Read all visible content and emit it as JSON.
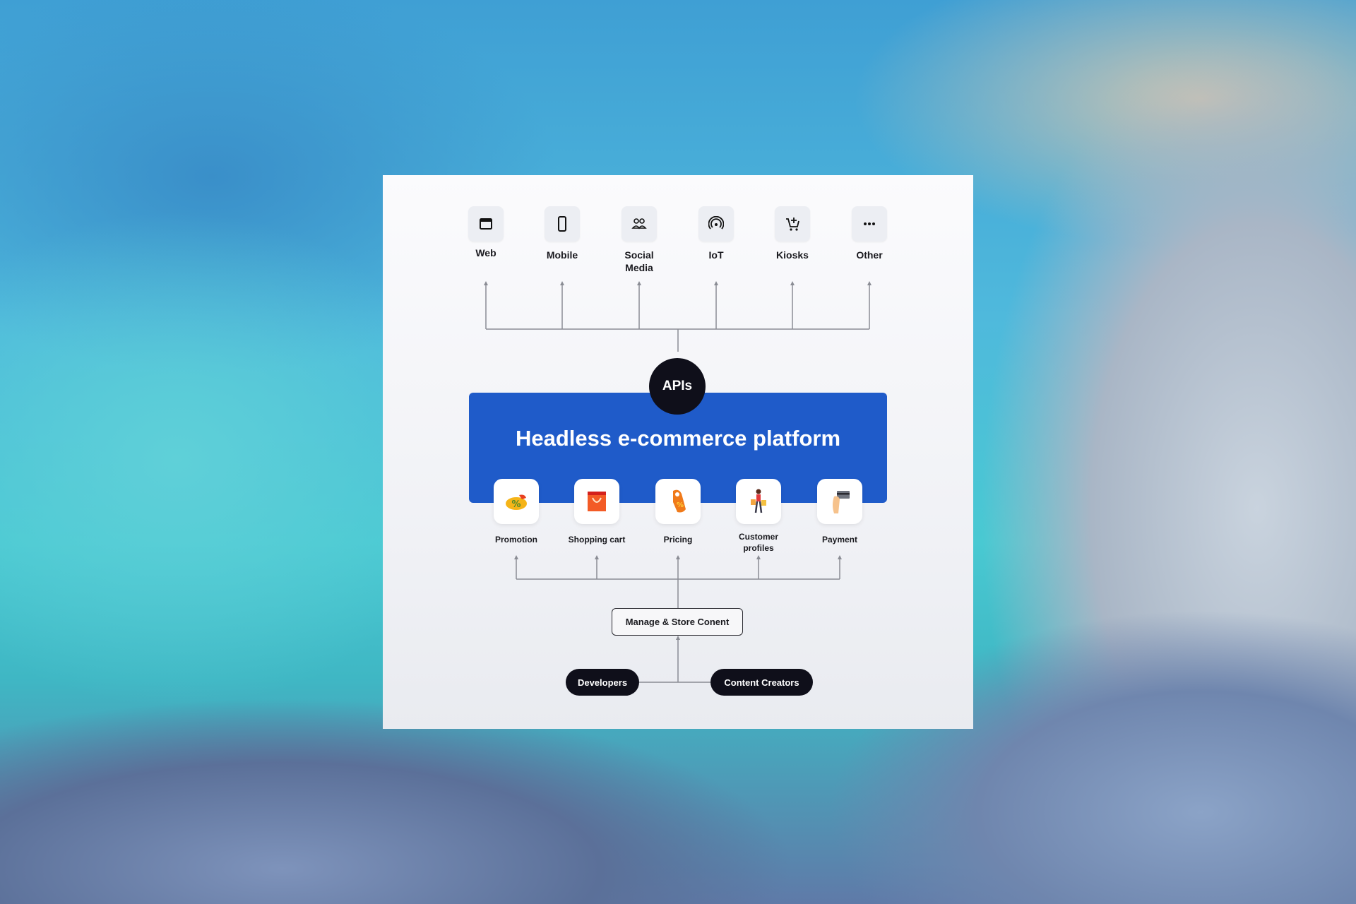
{
  "diagram": {
    "channels": [
      {
        "label": "Web",
        "icon": "browser-window-icon"
      },
      {
        "label": "Mobile",
        "icon": "smartphone-icon"
      },
      {
        "label": "Social\nMedia",
        "label_lines": [
          "Social",
          "Media"
        ],
        "icon": "people-icon"
      },
      {
        "label": "IoT",
        "icon": "wireless-signal-icon"
      },
      {
        "label": "Kiosks",
        "icon": "cart-plus-icon"
      },
      {
        "label": "Other",
        "icon": "more-dots-icon"
      }
    ],
    "api_label": "APIs",
    "platform_title": "Headless e-commerce platform",
    "features": [
      {
        "label_lines": [
          "Promotion"
        ],
        "icon": "promotion-tag-icon"
      },
      {
        "label_lines": [
          "Shopping cart"
        ],
        "icon": "shopping-bag-icon"
      },
      {
        "label_lines": [
          "Pricing"
        ],
        "icon": "price-tag-icon"
      },
      {
        "label_lines": [
          "Customer",
          "profiles"
        ],
        "icon": "shopper-icon"
      },
      {
        "label_lines": [
          "Payment"
        ],
        "icon": "card-payment-icon"
      }
    ],
    "content_hub": "Manage & Store Conent",
    "actors": [
      "Developers",
      "Content Creators"
    ]
  },
  "colors": {
    "platform_blue": "#1f5bc9",
    "dark": "#0f0f1a",
    "connector": "#8a8c94"
  }
}
